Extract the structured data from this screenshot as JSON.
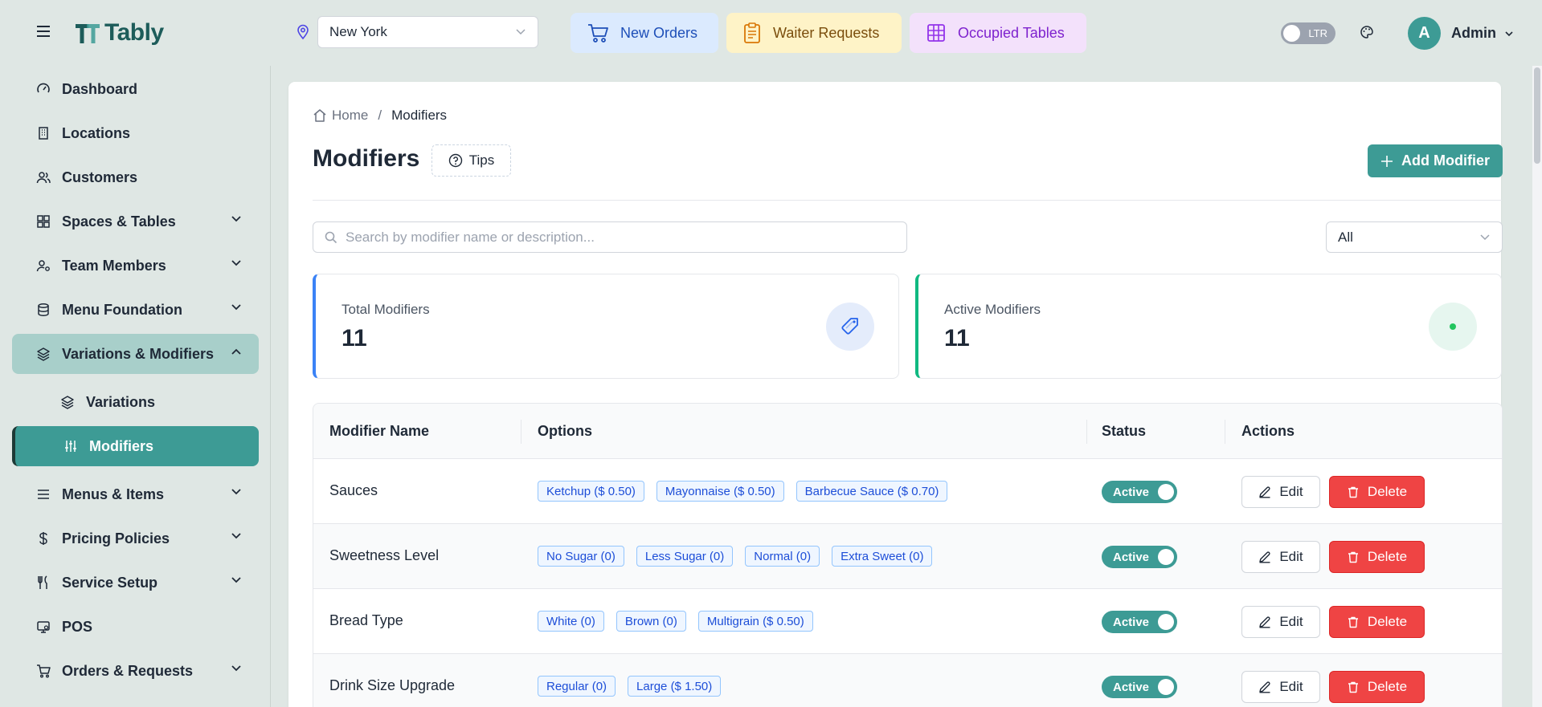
{
  "brand": {
    "name": "Tably",
    "color": "#1d5c5a",
    "accent": "#3d9b95"
  },
  "header": {
    "location": "New York",
    "quick_links": [
      {
        "label": "New Orders",
        "icon": "cart-icon"
      },
      {
        "label": "Waiter Requests",
        "icon": "clipboard-icon"
      },
      {
        "label": "Occupied Tables",
        "icon": "grid-icon"
      }
    ],
    "direction_toggle": "LTR",
    "user": {
      "initial": "A",
      "name": "Admin"
    }
  },
  "sidebar": {
    "items": [
      {
        "label": "Dashboard",
        "icon": "gauge-icon"
      },
      {
        "label": "Locations",
        "icon": "building-icon"
      },
      {
        "label": "Customers",
        "icon": "users-icon"
      },
      {
        "label": "Spaces & Tables",
        "icon": "grid-icon"
      },
      {
        "label": "Team Members",
        "icon": "user-cog-icon"
      },
      {
        "label": "Menu Foundation",
        "icon": "database-icon"
      },
      {
        "label": "Variations & Modifiers",
        "icon": "layers-icon"
      },
      {
        "label": "Variations",
        "icon": "layers-icon"
      },
      {
        "label": "Modifiers",
        "icon": "sliders-icon"
      },
      {
        "label": "Menus & Items",
        "icon": "list-icon"
      },
      {
        "label": "Pricing Policies",
        "icon": "dollar-icon"
      },
      {
        "label": "Service Setup",
        "icon": "utensils-icon"
      },
      {
        "label": "POS",
        "icon": "pos-icon"
      },
      {
        "label": "Orders & Requests",
        "icon": "cart-icon"
      }
    ]
  },
  "page": {
    "breadcrumb": {
      "home": "Home",
      "sep": "/",
      "current": "Modifiers"
    },
    "title": "Modifiers",
    "tips_label": "Tips",
    "add_label": "Add Modifier",
    "search_placeholder": "Search by modifier name or description...",
    "filter_value": "All"
  },
  "stats": {
    "total": {
      "label": "Total Modifiers",
      "value": "11"
    },
    "active": {
      "label": "Active Modifiers",
      "value": "11"
    }
  },
  "table": {
    "columns": [
      "Modifier Name",
      "Options",
      "Status",
      "Actions"
    ],
    "rows": [
      {
        "name": "Sauces",
        "options": [
          "Ketchup ($ 0.50)",
          "Mayonnaise ($ 0.50)",
          "Barbecue Sauce ($ 0.70)"
        ],
        "status": "Active"
      },
      {
        "name": "Sweetness Level",
        "options": [
          "No Sugar (0)",
          "Less Sugar (0)",
          "Normal (0)",
          "Extra Sweet (0)"
        ],
        "status": "Active"
      },
      {
        "name": "Bread Type",
        "options": [
          "White (0)",
          "Brown (0)",
          "Multigrain ($ 0.50)"
        ],
        "status": "Active"
      },
      {
        "name": "Drink Size Upgrade",
        "options": [
          "Regular (0)",
          "Large ($ 1.50)"
        ],
        "status": "Active"
      }
    ],
    "edit_label": "Edit",
    "delete_label": "Delete"
  }
}
